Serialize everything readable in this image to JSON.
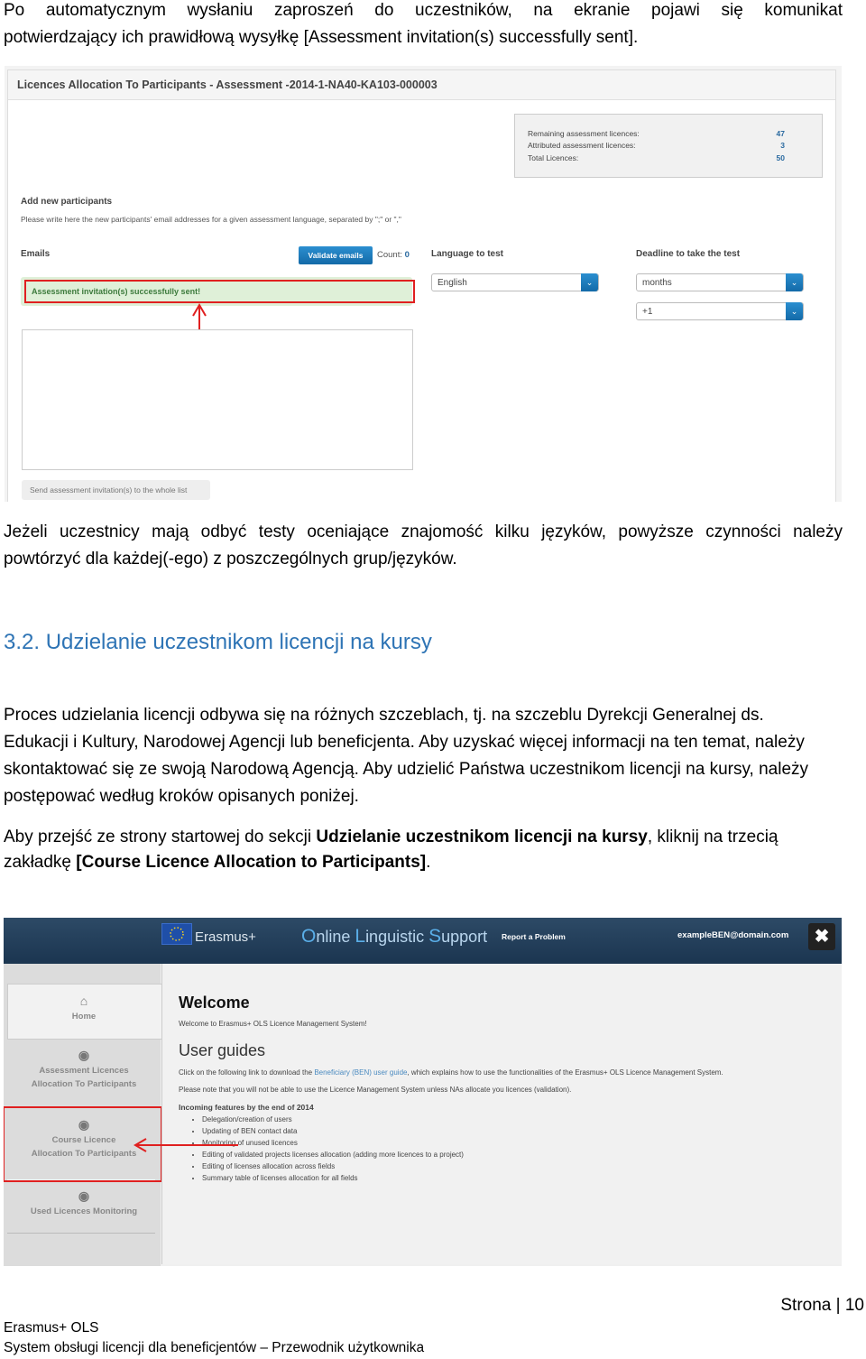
{
  "intro_paragraph": "Po automatycznym wysłaniu zaproszeń do uczestników, na ekranie pojawi się komunikat potwierdzający ich prawidłową wysyłkę [Assessment invitation(s) successfully sent].",
  "intro_line1": "Po automatycznym wysłaniu zaproszeń do uczestników, na ekranie pojawi się komunikat",
  "intro_line2": "potwierdzający ich prawidłową wysyłkę [Assessment invitation(s) successfully sent].",
  "screenshot1": {
    "title": "Licences Allocation To Participants - Assessment -2014-1-NA40-KA103-000003",
    "stats": [
      {
        "label": "Remaining assessment licences:",
        "value": "47"
      },
      {
        "label": "Attributed assessment licences:",
        "value": "3"
      },
      {
        "label": "Total Licences:",
        "value": "50"
      }
    ],
    "add_heading": "Add new participants",
    "add_description": "Please write here the new participants' email addresses for a given assessment language, separated by \";\" or \",\"",
    "emails_label": "Emails",
    "validate_button": "Validate emails",
    "count_label": "Count:",
    "count_value": "0",
    "success_alert": "Assessment invitation(s) successfully sent!",
    "language_label": "Language to test",
    "language_value": "English",
    "deadline_label": "Deadline to take the test",
    "deadline_unit": "months",
    "deadline_amount": "+1",
    "send_button": "Send assessment invitation(s) to the whole list",
    "annotation_color": "#e02020"
  },
  "paragraph2_line1": "Jeżeli uczestnicy mają odbyć testy oceniające znajomość kilku języków, powyższe czynności należy",
  "paragraph2_line2": "powtórzyć dla każdej(-ego) z poszczególnych grup/języków.",
  "section_heading": "3.2. Udzielanie uczestnikom licencji na kursy",
  "paragraph3": "Proces udzielania licencji odbywa się na różnych szczeblach, tj. na szczeblu Dyrekcji Generalnej ds. Edukacji i Kultury, Narodowej Agencji lub beneficjenta. Aby uzyskać więcej informacji na ten temat, należy skontaktować się ze swoją Narodową Agencją. Aby udzielić Państwa uczestnikom licencji na kursy, należy postępować według kroków opisanych poniżej.",
  "paragraph4": {
    "before": "Aby przejść ze strony startowej do sekcji ",
    "bold1": "Udzielanie uczestnikom licencji na kursy",
    "middle": ", kliknij na trzecią zakładkę ",
    "bold2": "[Course Licence Allocation to Participants]",
    "after": "."
  },
  "screenshot2": {
    "brand": "Erasmus+",
    "app_title_parts": [
      "O",
      "nline ",
      "L",
      "inguistic ",
      "S",
      "upport"
    ],
    "report_link": "Report a Problem",
    "user_email": "exampleBEN@domain.com",
    "close_icon": "close-x",
    "nav": [
      {
        "icon": "home-icon",
        "line1": "Home",
        "line2": ""
      },
      {
        "icon": "award-icon",
        "line1": "Assessment Licences",
        "line2": "Allocation To Participants"
      },
      {
        "icon": "award-icon",
        "line1": "Course Licence",
        "line2": "Allocation To Participants"
      },
      {
        "icon": "award-icon",
        "line1": "Used Licences Monitoring",
        "line2": ""
      }
    ],
    "welcome_title": "Welcome",
    "welcome_text": "Welcome to Erasmus+ OLS Licence Management System!",
    "guides_title": "User guides",
    "guides_text_before": "Click on the following link to download the ",
    "guides_link": "Beneficiary (BEN) user guide",
    "guides_text_after": ", which explains how to use the functionalities of the Erasmus+ OLS Licence Management System.",
    "note_text": "Please note that you will not be able to use the Licence Management System unless NAs allocate you licences (validation).",
    "features_title": "Incoming features by the end of 2014",
    "features": [
      "Delegation/creation of users",
      "Updating of BEN contact data",
      "Monitoring of unused licences",
      "Editing of validated projects licenses allocation (adding more licences to a project)",
      "Editing of licenses allocation across fields",
      "Summary table of licenses allocation for all fields"
    ],
    "link_color": "#4a8ac0"
  },
  "footer": {
    "page_label": "Strona",
    "page_number": "10",
    "line1": "Erasmus+ OLS",
    "line2": "System obsługi licencji dla beneficjentów – Przewodnik użytkownika"
  }
}
